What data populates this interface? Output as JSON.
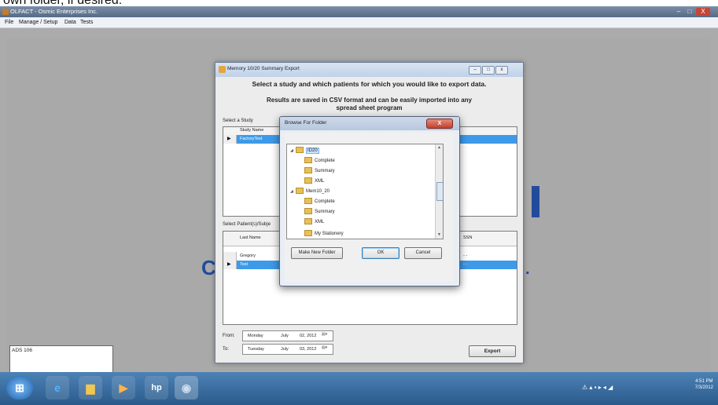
{
  "doc_fragment": "own folder, if desired.",
  "app": {
    "title": "OLFACT - Osmic Enterprises Inc.",
    "menu": [
      "File",
      "Manage / Setup",
      "Data",
      "Tests"
    ],
    "window_controls": {
      "minimize": "–",
      "maximize": "□",
      "close": "X"
    }
  },
  "dialog": {
    "title": "Memory 10/20 Summary Export",
    "instruction": "Select a study and which patients for which you would like to export data.",
    "note": "Results are saved in CSV format and can be easily imported into any spread sheet program",
    "select_study_label": "Select a Study",
    "study_columns": [
      "Study Name"
    ],
    "study_rows": [
      {
        "name": "FactoryTest",
        "selected": true
      }
    ],
    "select_patients_label": "Select Patient(s)/Subje",
    "patient_columns": [
      "Last Name",
      "SSN"
    ],
    "patient_rows": [
      {
        "last_name": "Gregory",
        "ssn": "- -",
        "selected": false
      },
      {
        "last_name": "Test",
        "ssn": "- -",
        "selected": true
      }
    ],
    "from_label": "From:",
    "to_label": "To:",
    "from_date": {
      "day": "Monday",
      "month": "July",
      "date": "02, 2012"
    },
    "to_date": {
      "day": "Tuesday",
      "month": "July",
      "date": "03, 2012"
    },
    "export_label": "Export"
  },
  "browse": {
    "title": "Browse For Folder",
    "close_label": "X",
    "tree": [
      {
        "name": "ID20",
        "level": 0,
        "expanded": true,
        "selected": true
      },
      {
        "name": "Complete",
        "level": 1
      },
      {
        "name": "Summary",
        "level": 1
      },
      {
        "name": "XML",
        "level": 1
      },
      {
        "name": "Mem10_20",
        "level": 0,
        "expanded": true
      },
      {
        "name": "Complete",
        "level": 1
      },
      {
        "name": "Summary",
        "level": 1
      },
      {
        "name": "XML",
        "level": 1
      },
      {
        "name": "My Stationery",
        "level": 0
      }
    ],
    "make_new_folder": "Make New Folder",
    "ok": "OK",
    "cancel": "Cancel"
  },
  "ads": "ADS 106",
  "clock": {
    "time": "4:51 PM",
    "date": "7/3/2012"
  },
  "colors": {
    "selection": "#3d9ae8",
    "taskbar": "#2a5a8b",
    "brand_blue": "#224b9c"
  }
}
